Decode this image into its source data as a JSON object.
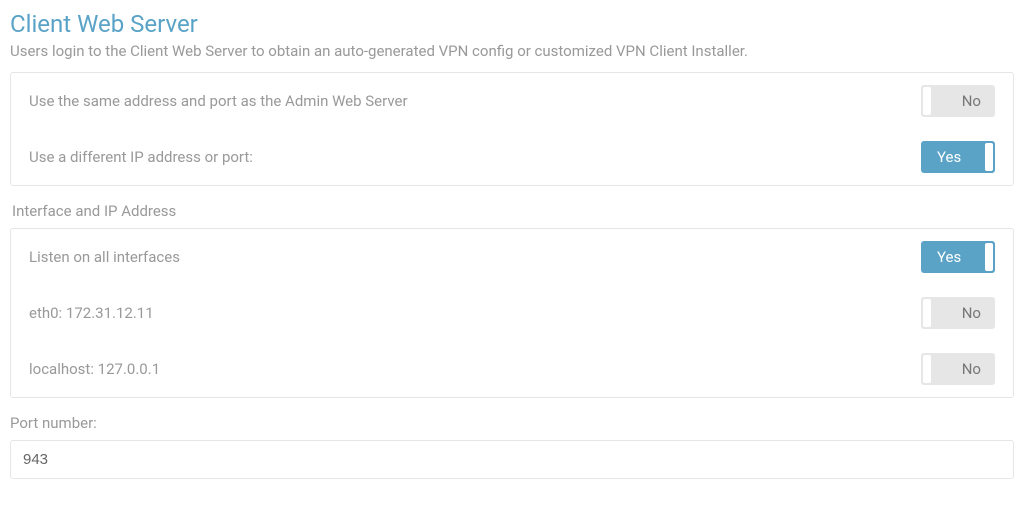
{
  "page": {
    "title": "Client Web Server",
    "description": "Users login to the Client Web Server to obtain an auto-generated VPN config or customized VPN Client Installer."
  },
  "server_mode": {
    "same_as_admin": {
      "label": "Use the same address and port as the Admin Web Server",
      "state": "No"
    },
    "different_ip": {
      "label": "Use a different IP address or port:",
      "state": "Yes"
    }
  },
  "interface_section": {
    "heading": "Interface and IP Address",
    "listen_all": {
      "label": "Listen on all interfaces",
      "state": "Yes"
    },
    "eth0": {
      "label": "eth0: 172.31.12.11",
      "state": "No"
    },
    "localhost": {
      "label": "localhost: 127.0.0.1",
      "state": "No"
    }
  },
  "port": {
    "label": "Port number:",
    "value": "943"
  },
  "toggle_labels": {
    "yes": "Yes",
    "no": "No"
  }
}
